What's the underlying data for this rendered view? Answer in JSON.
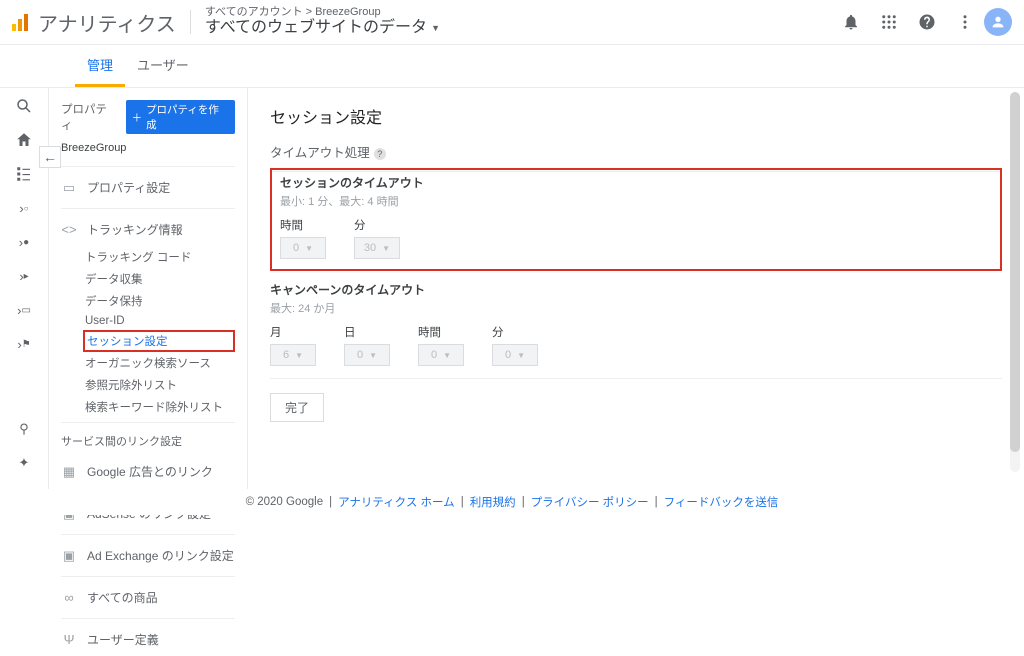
{
  "app": {
    "title": "アナリティクス"
  },
  "breadcrumb": {
    "small": "すべてのアカウント > BreezeGroup",
    "large": "すべてのウェブサイトのデータ"
  },
  "tabs": {
    "admin": "管理",
    "user": "ユーザー"
  },
  "side": {
    "prop_label": "プロパティ",
    "create": "プロパティを作成",
    "property_name": "BreezeGroup",
    "items": {
      "settings": "プロパティ設定",
      "tracking": "トラッキング情報",
      "link_section": "サービス間のリンク設定",
      "ads": "Google 広告とのリンク",
      "adsense": "AdSense のリンク設定",
      "adx": "Ad Exchange のリンク設定",
      "products": "すべての商品",
      "userdef": "ユーザー定義"
    },
    "tracking_sub": {
      "code": "トラッキング コード",
      "collect": "データ収集",
      "retain": "データ保持",
      "userid": "User-ID",
      "session": "セッション設定",
      "organic": "オーガニック検索ソース",
      "ref_excl": "参照元除外リスト",
      "kw_excl": "検索キーワード除外リスト"
    }
  },
  "content": {
    "title": "セッション設定",
    "timeout_section": "タイムアウト処理",
    "session": {
      "title": "セッションのタイムアウト",
      "hint": "最小: 1 分、最大: 4 時間",
      "c_hour": "時間",
      "c_min": "分",
      "v_hour": "0",
      "v_min": "30"
    },
    "campaign": {
      "title": "キャンペーンのタイムアウト",
      "hint": "最大: 24 か月",
      "c_month": "月",
      "c_day": "日",
      "c_hour": "時間",
      "c_min": "分",
      "v_month": "6",
      "v_day": "0",
      "v_hour": "0",
      "v_min": "0"
    },
    "done": "完了"
  },
  "footer": {
    "copyright": "© 2020 Google",
    "home": "アナリティクス ホーム",
    "terms": "利用規約",
    "privacy": "プライバシー ポリシー",
    "feedback": "フィードバックを送信"
  }
}
